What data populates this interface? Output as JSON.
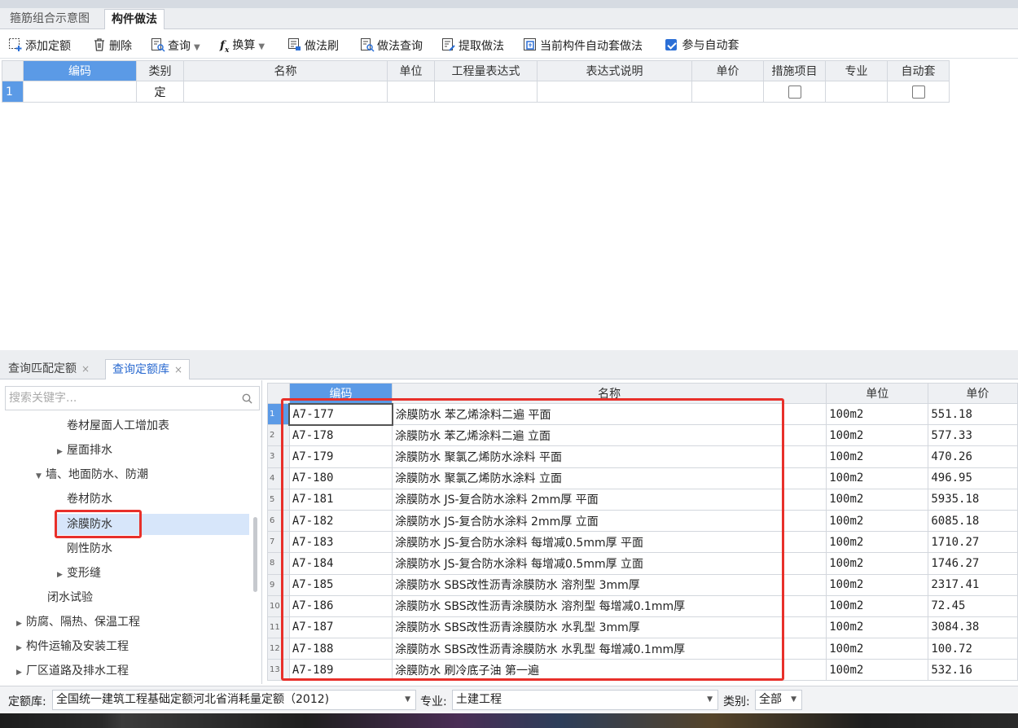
{
  "top_tabs": [
    "箍筋组合示意图",
    "构件做法"
  ],
  "toolbar": {
    "add_quota": "添加定额",
    "delete": "删除",
    "query": "查询",
    "convert": "换算",
    "method_brush": "做法刷",
    "method_query": "做法查询",
    "extract_method": "提取做法",
    "auto_method": "当前构件自动套做法",
    "join_auto": "参与自动套"
  },
  "upper_table": {
    "headers": [
      "编码",
      "类别",
      "名称",
      "单位",
      "工程量表达式",
      "表达式说明",
      "单价",
      "措施项目",
      "专业",
      "自动套"
    ],
    "row": {
      "num": "1",
      "category": "定"
    }
  },
  "bottom_tabs": [
    "查询匹配定额",
    "查询定额库"
  ],
  "search": {
    "placeholder": "搜索关键字..."
  },
  "tree": [
    "卷材屋面人工增加表",
    "屋面排水",
    "墙、地面防水、防潮",
    "卷材防水",
    "涂膜防水",
    "刚性防水",
    "变形缝",
    "闭水试验",
    "防腐、隔热、保温工程",
    "构件运输及安装工程",
    "厂区道路及排水工程"
  ],
  "lower_table": {
    "headers": [
      "编码",
      "名称",
      "单位",
      "单价"
    ],
    "rows": [
      {
        "n": "1",
        "code": "A7-177",
        "name": "涂膜防水 苯乙烯涂料二遍 平面",
        "unit": "100m2",
        "price": "551.18"
      },
      {
        "n": "2",
        "code": "A7-178",
        "name": "涂膜防水 苯乙烯涂料二遍 立面",
        "unit": "100m2",
        "price": "577.33"
      },
      {
        "n": "3",
        "code": "A7-179",
        "name": "涂膜防水 聚氯乙烯防水涂料 平面",
        "unit": "100m2",
        "price": "470.26"
      },
      {
        "n": "4",
        "code": "A7-180",
        "name": "涂膜防水 聚氯乙烯防水涂料 立面",
        "unit": "100m2",
        "price": "496.95"
      },
      {
        "n": "5",
        "code": "A7-181",
        "name": "涂膜防水 JS-复合防水涂料 2mm厚 平面",
        "unit": "100m2",
        "price": "5935.18"
      },
      {
        "n": "6",
        "code": "A7-182",
        "name": "涂膜防水 JS-复合防水涂料 2mm厚 立面",
        "unit": "100m2",
        "price": "6085.18"
      },
      {
        "n": "7",
        "code": "A7-183",
        "name": "涂膜防水 JS-复合防水涂料 每增减0.5mm厚 平面",
        "unit": "100m2",
        "price": "1710.27"
      },
      {
        "n": "8",
        "code": "A7-184",
        "name": "涂膜防水 JS-复合防水涂料 每增减0.5mm厚 立面",
        "unit": "100m2",
        "price": "1746.27"
      },
      {
        "n": "9",
        "code": "A7-185",
        "name": "涂膜防水 SBS改性沥青涂膜防水 溶剂型 3mm厚",
        "unit": "100m2",
        "price": "2317.41"
      },
      {
        "n": "10",
        "code": "A7-186",
        "name": "涂膜防水 SBS改性沥青涂膜防水 溶剂型 每增减0.1mm厚",
        "unit": "100m2",
        "price": "72.45"
      },
      {
        "n": "11",
        "code": "A7-187",
        "name": "涂膜防水 SBS改性沥青涂膜防水 水乳型 3mm厚",
        "unit": "100m2",
        "price": "3084.38"
      },
      {
        "n": "12",
        "code": "A7-188",
        "name": "涂膜防水 SBS改性沥青涂膜防水 水乳型 每增减0.1mm厚",
        "unit": "100m2",
        "price": "100.72"
      },
      {
        "n": "13",
        "code": "A7-189",
        "name": "涂膜防水 刷冷底子油 第一遍",
        "unit": "100m2",
        "price": "532.16"
      }
    ]
  },
  "bottom_bar": {
    "quota_lib_label": "定额库:",
    "quota_lib_value": "全国统一建筑工程基础定额河北省消耗量定额（2012)",
    "major_label": "专业:",
    "major_value": "土建工程",
    "category_label": "类别:",
    "category_value": "全部"
  },
  "colors": {
    "accent": "#5b9ae6",
    "highlight_red": "#e8302a",
    "selected_tree": "#d7e6fa",
    "tab_active_text": "#2a6ad0"
  }
}
